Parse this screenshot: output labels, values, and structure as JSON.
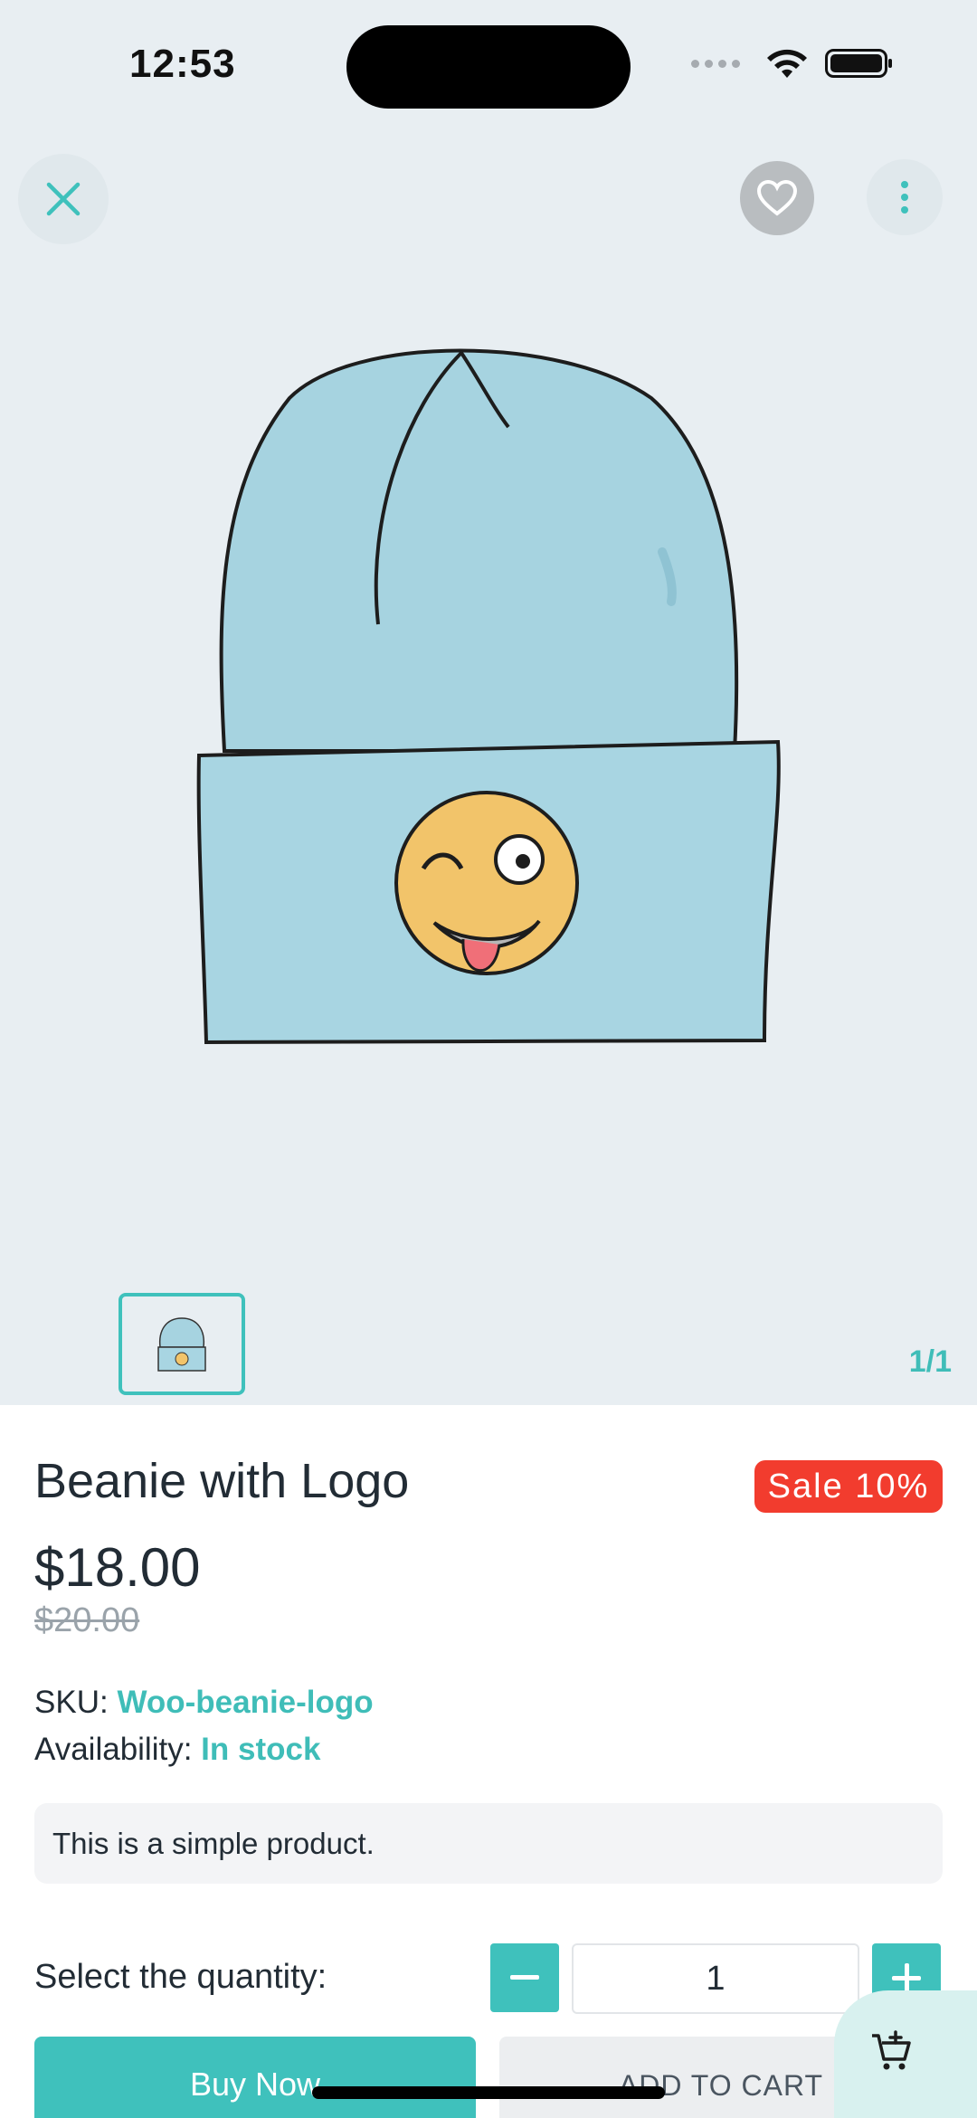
{
  "status_bar": {
    "time": "12:53"
  },
  "top_bar": {
    "close_icon": "close-icon",
    "favorite_icon": "heart-icon",
    "more_icon": "more-vertical-icon"
  },
  "gallery": {
    "counter": "1/1"
  },
  "product": {
    "title": "Beanie with Logo",
    "sale_badge": "Sale 10%",
    "price": "$18.00",
    "old_price": "$20.00",
    "sku_label": "SKU:",
    "sku_value": "Woo-beanie-logo",
    "availability_label": "Availability:",
    "availability_value": "In stock",
    "description": "This is a simple product."
  },
  "quantity": {
    "label": "Select the quantity:",
    "value": "1"
  },
  "actions": {
    "buy_now": "Buy Now",
    "add_to_cart": "ADD TO CART"
  },
  "colors": {
    "accent": "#3fc1bc",
    "sale": "#f23c2e",
    "hero_bg": "#e8eef2"
  }
}
